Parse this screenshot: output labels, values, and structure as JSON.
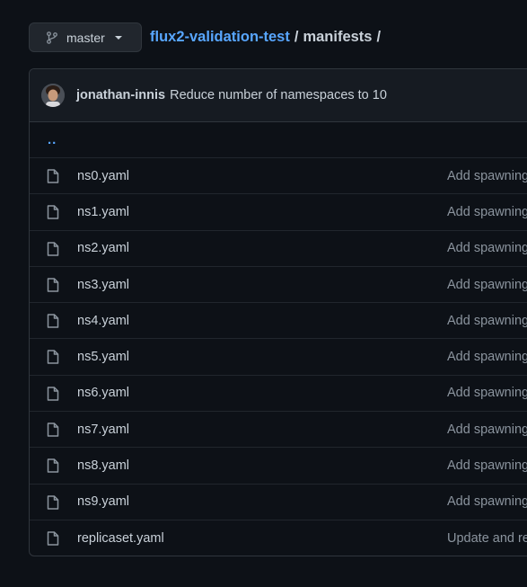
{
  "branch": {
    "name": "master"
  },
  "breadcrumb": {
    "repo": "flux2-validation-test",
    "separator": "/",
    "directory": "manifests",
    "trailing": "/"
  },
  "latest_commit": {
    "author": "jonathan-innis",
    "message": "Reduce number of namespaces to 10"
  },
  "parent_link": "..",
  "files": [
    {
      "name": "ns0.yaml",
      "message": "Add spawning"
    },
    {
      "name": "ns1.yaml",
      "message": "Add spawning"
    },
    {
      "name": "ns2.yaml",
      "message": "Add spawning"
    },
    {
      "name": "ns3.yaml",
      "message": "Add spawning"
    },
    {
      "name": "ns4.yaml",
      "message": "Add spawning"
    },
    {
      "name": "ns5.yaml",
      "message": "Add spawning"
    },
    {
      "name": "ns6.yaml",
      "message": "Add spawning"
    },
    {
      "name": "ns7.yaml",
      "message": "Add spawning"
    },
    {
      "name": "ns8.yaml",
      "message": "Add spawning"
    },
    {
      "name": "ns9.yaml",
      "message": "Add spawning"
    },
    {
      "name": "replicaset.yaml",
      "message": "Update and re"
    }
  ],
  "icons": {
    "branch": "git-branch-icon",
    "file": "file-icon",
    "caret": "caret-down-icon"
  }
}
